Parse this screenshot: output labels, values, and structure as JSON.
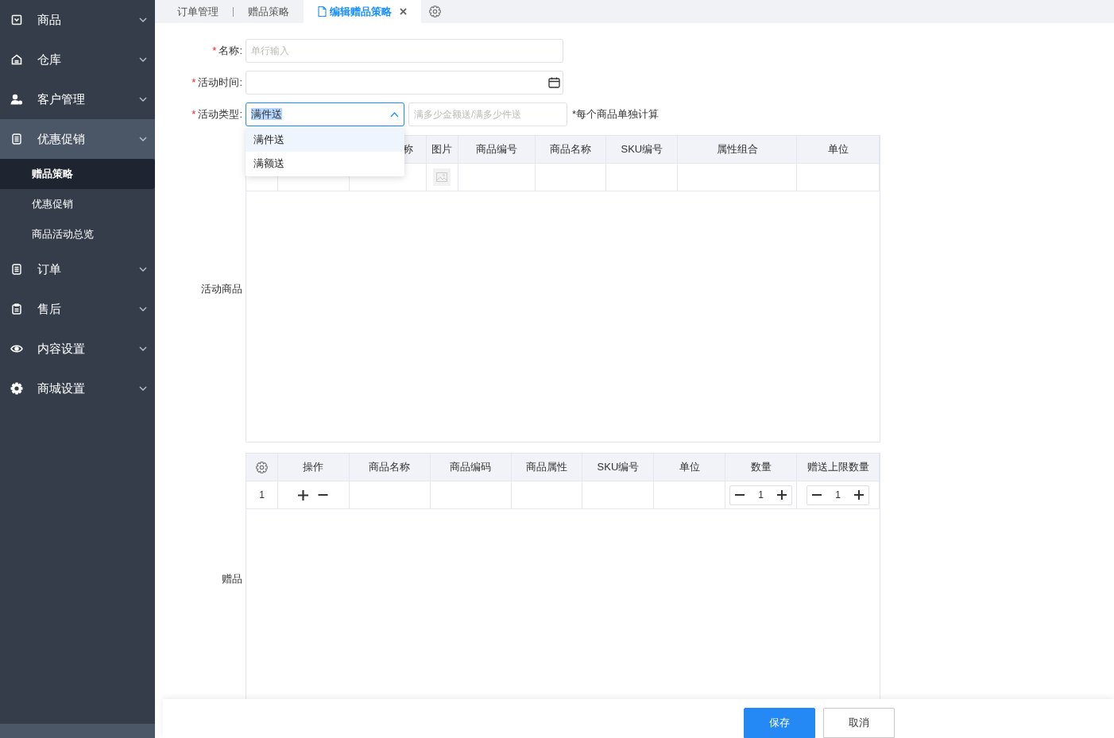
{
  "sidebar": {
    "items": [
      {
        "label": "商品",
        "expanded": false
      },
      {
        "label": "仓库",
        "expanded": false
      },
      {
        "label": "客户管理",
        "expanded": false
      },
      {
        "label": "优惠促销",
        "expanded": true,
        "children": [
          {
            "label": "赠品策略",
            "selected": true
          },
          {
            "label": "优惠促销",
            "selected": false
          },
          {
            "label": "商品活动总览",
            "selected": false
          }
        ]
      },
      {
        "label": "订单",
        "expanded": false
      },
      {
        "label": "售后",
        "expanded": false
      },
      {
        "label": "内容设置",
        "expanded": false
      },
      {
        "label": "商城设置",
        "expanded": false
      }
    ]
  },
  "tabs": [
    {
      "label": "订单管理",
      "selected": false
    },
    {
      "label": "赠品策略",
      "selected": false
    },
    {
      "label": "编辑赠品策略",
      "selected": true
    }
  ],
  "form": {
    "name": {
      "label": "名称:",
      "mark": "*",
      "placeholder": "单行输入"
    },
    "time": {
      "label": "活动时间:",
      "mark": "*"
    },
    "type": {
      "label": "活动类型:",
      "mark": "*",
      "value": "满件送",
      "open": true,
      "options": [
        {
          "label": "满件送",
          "selected": true
        },
        {
          "label": "满额送",
          "selected": false
        }
      ],
      "threshold_placeholder": "满多少金额送/满多少件送",
      "note": "*每个商品单独计算"
    }
  },
  "products": {
    "label": "活动商品",
    "columns": [
      "",
      "",
      "称",
      "图片",
      "商品编号",
      "商品名称",
      "SKU编号",
      "属性组合",
      "单位"
    ]
  },
  "gifts": {
    "label": "赠品",
    "columns": [
      "操作",
      "商品名称",
      "商品编码",
      "商品属性",
      "SKU编号",
      "单位",
      "数量",
      "赠送上限数量"
    ],
    "rows": [
      {
        "index": "1",
        "quantity": "1",
        "limit": "1"
      }
    ]
  },
  "buttons": [
    {
      "label": "保存",
      "kind": "primary"
    },
    {
      "label": "取消",
      "kind": "default"
    }
  ]
}
